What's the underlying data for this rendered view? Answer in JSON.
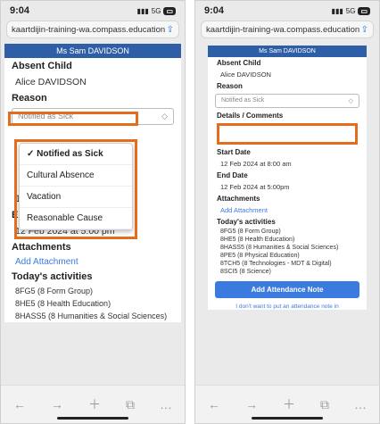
{
  "status_time": "9:04",
  "network": "5G",
  "url": "kaartdijin-training-wa.compass.education",
  "left": {
    "staff_name": "Ms Sam DAVIDSON",
    "absent_child_label": "Absent Child",
    "absent_child_value": "Alice DAVIDSON",
    "reason_label": "Reason",
    "reason_value": "Notified as Sick",
    "dropdown_options": [
      "✓ Notified as Sick",
      "Cultural Absence",
      "Vacation",
      "Reasonable Cause"
    ],
    "start_date_value": "12 Feb 2024 at 8:00am",
    "end_date_label": "End Date",
    "end_date_value": "12 Feb 2024 at 5:00 pm",
    "attachments_label": "Attachments",
    "add_attachment": "Add Attachment",
    "activities_label": "Today's activities",
    "activities": [
      "8FG5 (8 Form Group)",
      "8HE5 (8 Health Education)",
      "8HASS5 (8 Humanities & Social Sciences)"
    ]
  },
  "right": {
    "staff_name": "Ms Sam DAVIDSON",
    "absent_child_label": "Absent Child",
    "absent_child_value": "Alice DAVIDSON",
    "reason_label": "Reason",
    "reason_value": "Notified as Sick",
    "details_label": "Details / Comments",
    "start_date_label": "Start Date",
    "start_date_value": "12 Feb 2024 at 8:00 am",
    "end_date_label": "End Date",
    "end_date_value": "12 Feb 2024 at 5:00pm",
    "attachments_label": "Attachments",
    "add_attachment": "Add Attachment",
    "activities_label": "Today's activities",
    "activities": [
      "8FG5 (8 Form Group)",
      "8HE5 (8 Health Education)",
      "8HASS5 (8 Humanities & Social Sciences)",
      "8PE5 (8 Physical Education)",
      "8TCH5 (8 Technologies - MDT & Digital)",
      "8SCI5 (8 Science)"
    ],
    "add_note_button": "Add Attendance Note",
    "skip_link": "I don't want to put an attendance note in"
  },
  "nav_icons": [
    "back-arrow-icon",
    "forward-arrow-icon",
    "plus-icon",
    "tabs-icon",
    "more-icon"
  ]
}
